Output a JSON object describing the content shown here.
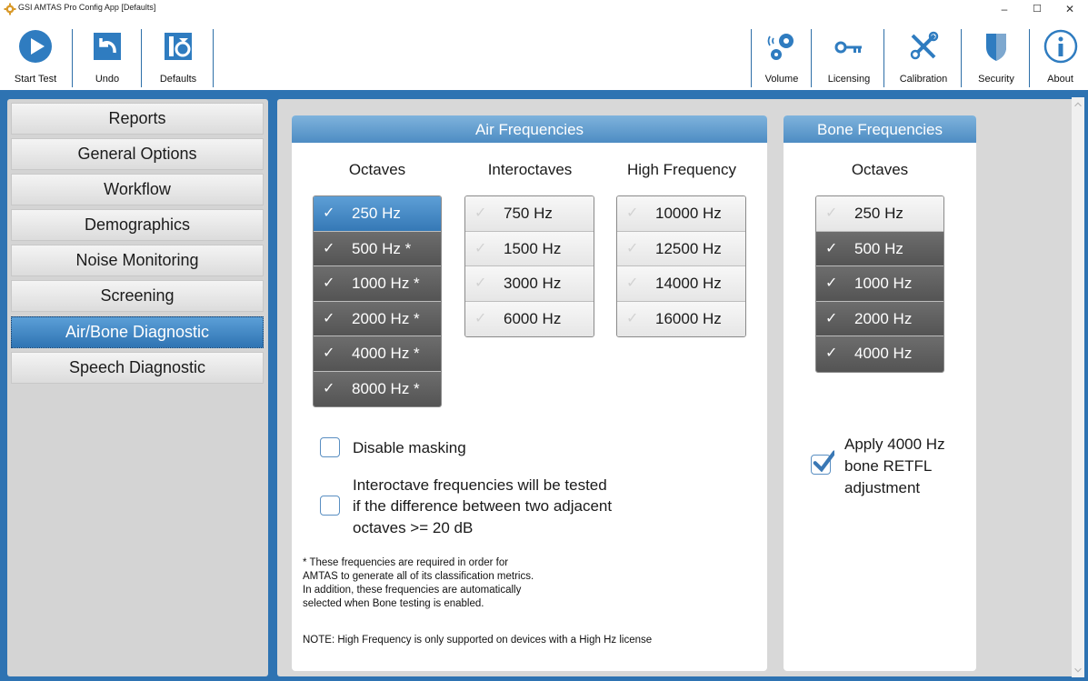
{
  "window": {
    "title": "GSI AMTAS Pro Config App [Defaults]",
    "minimize": "–",
    "maximize": "☐",
    "close": "✕"
  },
  "toolbar": {
    "start_test": "Start Test",
    "undo": "Undo",
    "defaults": "Defaults",
    "volume": "Volume",
    "licensing": "Licensing",
    "calibration": "Calibration",
    "security": "Security",
    "about": "About"
  },
  "nav": {
    "items": [
      {
        "label": "Reports"
      },
      {
        "label": "General Options"
      },
      {
        "label": "Workflow"
      },
      {
        "label": "Demographics"
      },
      {
        "label": "Noise Monitoring"
      },
      {
        "label": "Screening"
      },
      {
        "label": "Air/Bone Diagnostic"
      },
      {
        "label": "Speech Diagnostic"
      }
    ],
    "active": "Air/Bone Diagnostic"
  },
  "air": {
    "title": "Air Frequencies",
    "octaves_head": "Octaves",
    "interoctaves_head": "Interoctaves",
    "high_head": "High Frequency",
    "octaves": [
      {
        "label": "250 Hz",
        "state": "selected"
      },
      {
        "label": "500 Hz *",
        "state": "checked"
      },
      {
        "label": "1000 Hz *",
        "state": "checked"
      },
      {
        "label": "2000 Hz *",
        "state": "checked"
      },
      {
        "label": "4000 Hz *",
        "state": "checked"
      },
      {
        "label": "8000 Hz *",
        "state": "checked"
      }
    ],
    "interoctaves": [
      {
        "label": "750 Hz",
        "state": "unchecked"
      },
      {
        "label": "1500 Hz",
        "state": "unchecked"
      },
      {
        "label": "3000 Hz",
        "state": "unchecked"
      },
      {
        "label": "6000 Hz",
        "state": "unchecked"
      }
    ],
    "high": [
      {
        "label": "10000 Hz",
        "state": "unchecked"
      },
      {
        "label": "12500 Hz",
        "state": "unchecked"
      },
      {
        "label": "14000 Hz",
        "state": "unchecked"
      },
      {
        "label": "16000 Hz",
        "state": "unchecked"
      }
    ],
    "disable_masking": {
      "label": "Disable masking",
      "checked": false
    },
    "interoctave_rule": {
      "line1": "Interoctave frequencies will be tested",
      "line2": "if the difference between two adjacent",
      "line3": "octaves >= 20 dB",
      "checked": false
    },
    "note_lines": [
      "* These frequencies are required in order for",
      "AMTAS to generate all of its classification metrics.",
      "In addition, these frequencies are automatically",
      "selected when Bone testing is enabled."
    ],
    "high_note": "NOTE: High Frequency is only supported on devices with a High Hz license"
  },
  "bone": {
    "title": "Bone Frequencies",
    "octaves_head": "Octaves",
    "octaves": [
      {
        "label": "250 Hz",
        "state": "unchecked"
      },
      {
        "label": "500 Hz",
        "state": "checked"
      },
      {
        "label": "1000 Hz",
        "state": "checked"
      },
      {
        "label": "2000 Hz",
        "state": "checked"
      },
      {
        "label": "4000 Hz",
        "state": "checked"
      }
    ],
    "retfl": {
      "line1": "Apply 4000 Hz",
      "line2": "bone RETFL",
      "line3": "adjustment",
      "checked": true
    }
  },
  "check_glyph": "✓",
  "colors": {
    "accent": "#2e73b2",
    "selected": "#3579b6",
    "checked_item": "#5a5a5a"
  }
}
